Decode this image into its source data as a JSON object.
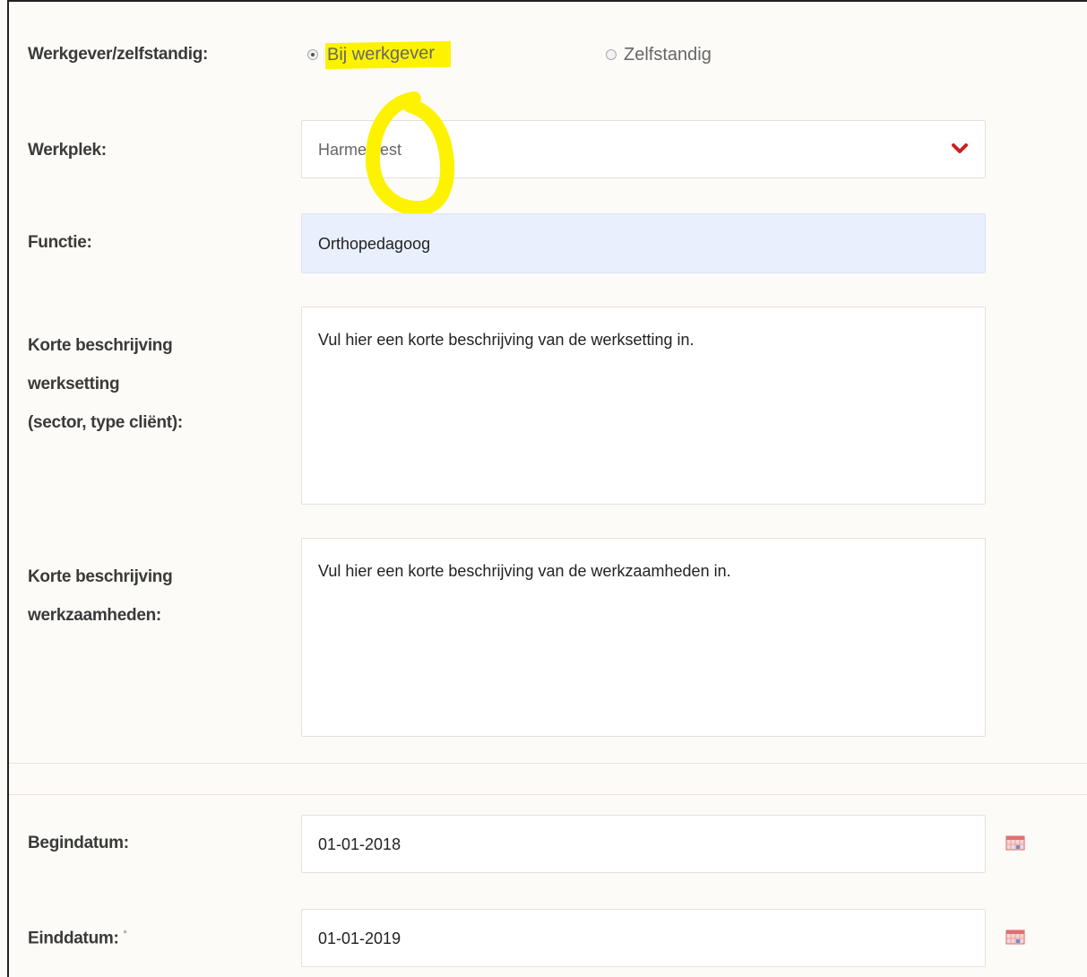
{
  "employer_type": {
    "label": "Werkgever/zelfstandig:",
    "options": [
      {
        "label": "Bij werkgever",
        "checked": true
      },
      {
        "label": "Zelfstandig",
        "checked": false
      }
    ]
  },
  "workplace": {
    "label": "Werkplek:",
    "selected": "Harmentest",
    "chevron_icon": "chevron-down-icon",
    "chevron_color": "#cc1f1f"
  },
  "function": {
    "label": "Functie:",
    "value": "Orthopedagoog",
    "background": "#e8f0fd"
  },
  "work_setting": {
    "label_lines": [
      "Korte beschrijving",
      "werksetting",
      "(sector, type cliënt):"
    ],
    "value": "Vul hier een korte beschrijving van de werksetting in."
  },
  "activities": {
    "label_lines": [
      "Korte beschrijving",
      "werkzaamheden:"
    ],
    "value": "Vul hier een korte beschrijving van de werkzaamheden in."
  },
  "start_date": {
    "label": "Begindatum:",
    "value": "01-01-2018",
    "icon": "calendar-icon"
  },
  "end_date": {
    "label": "Einddatum:",
    "required_marker": "*",
    "value": "01-01-2019",
    "icon": "calendar-icon"
  },
  "annotation": {
    "highlight_color": "#fdf200"
  }
}
